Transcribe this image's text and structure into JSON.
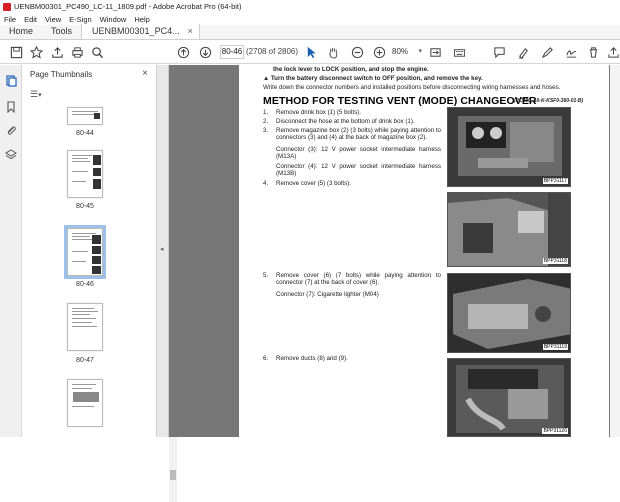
{
  "window": {
    "title": "UENBM00301_PC490_LC-11_1809.pdf - Adobe Acrobat Pro (64-bit)"
  },
  "menu": [
    "File",
    "Edit",
    "View",
    "E-Sign",
    "Window",
    "Help"
  ],
  "tabs": {
    "home": "Home",
    "tools": "Tools",
    "document": "UENBM00301_PC4...",
    "close": "×"
  },
  "toolbar": {
    "page_value": "80-46",
    "page_count": "(2708 of 2806)",
    "zoom": "80%"
  },
  "panel": {
    "title": "Page Thumbnails",
    "close": "×",
    "thumbnails": [
      {
        "label": "80-44"
      },
      {
        "label": "80-45"
      },
      {
        "label": "80-46",
        "selected": true
      },
      {
        "label": "80-47"
      },
      {
        "label": ""
      }
    ]
  },
  "document": {
    "intro_line1": "the lock lever to LOCK position, and stop the engine.",
    "intro_line2": "Turn the battery disconnect switch to OFF position, and remove the key.",
    "intro_line3": "Write down the connector numbers and installed positions before disconnecting wiring harnesses and hoses.",
    "heading": "METHOD FOR TESTING VENT (MODE) CHANGEOVER",
    "heading_code": "(PC490_10-K-KSF0-360-01-B)",
    "steps": [
      {
        "num": "1.",
        "text": "Remove drink box (1) (5 bolts)."
      },
      {
        "num": "2.",
        "text": "Disconnect the hose at the bottom of drink box (1)."
      },
      {
        "num": "3.",
        "text": "Remove magazine box (2) (3 bolts) while paying attention to connectors (3) and (4) at the back of magazine box (2)."
      },
      {
        "num": "",
        "text": "Connector (3): 12 V power socket intermediate harness (M13A)"
      },
      {
        "num": "",
        "text": "Connector (4): 12 V power socket intermediate harness (M13B)"
      },
      {
        "num": "4.",
        "text": "Remove cover (5) (3 bolts)."
      },
      {
        "num": "5.",
        "text": "Remove cover (6) (7 bolts) while paying attention to connector (7) at the back of cover (6)."
      },
      {
        "num": "",
        "text": "Connector (7): Cigarette lighter (M04)"
      },
      {
        "num": "6.",
        "text": "Remove ducts (8) and (9)."
      }
    ],
    "photo_tags": [
      "BPP31117",
      "BPP31118",
      "BPP31119",
      "BPP31120"
    ]
  },
  "colors": {
    "selection": "#9cc0e8",
    "app_red": "#d71f26",
    "doc_bg": "#777777"
  }
}
